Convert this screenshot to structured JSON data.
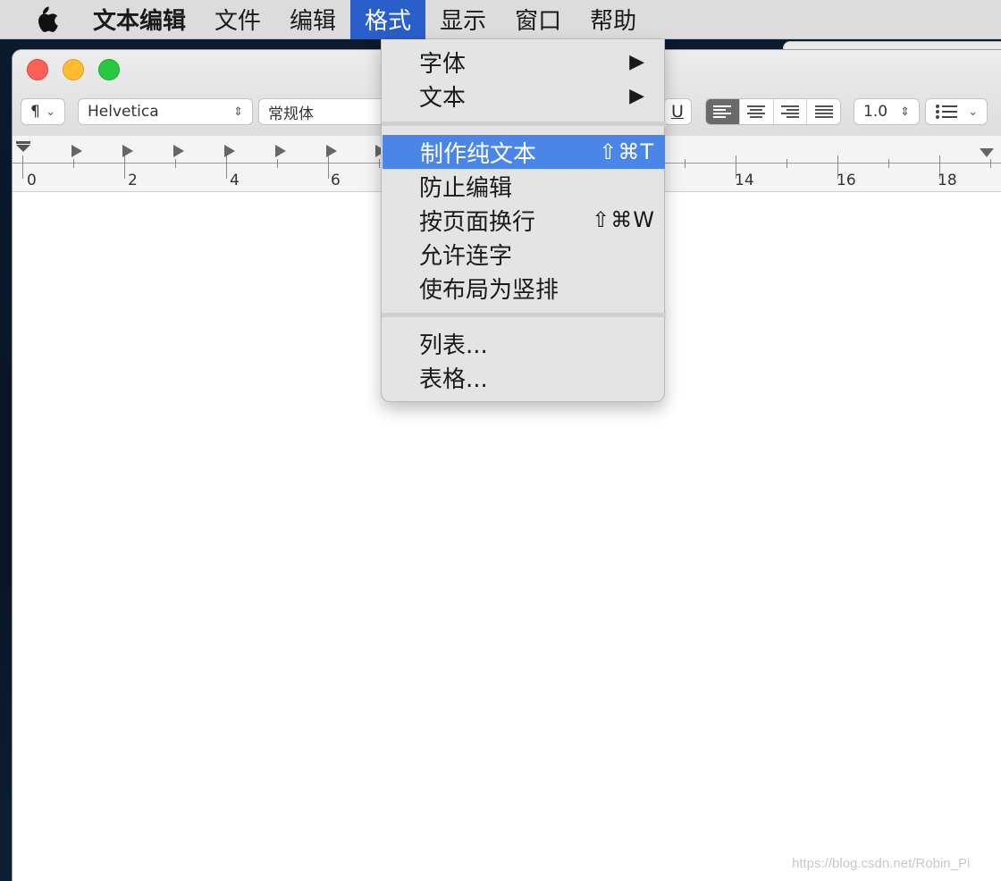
{
  "menubar": {
    "apple_icon": "apple-logo-icon",
    "items": [
      {
        "label": "文本编辑"
      },
      {
        "label": "文件"
      },
      {
        "label": "编辑"
      },
      {
        "label": "格式"
      },
      {
        "label": "显示"
      },
      {
        "label": "窗口"
      },
      {
        "label": "帮助"
      }
    ]
  },
  "toolbar": {
    "paragraph_symbol": "¶",
    "font_family": "Helvetica",
    "font_style": "常规体",
    "underline": "U",
    "line_spacing": "1.0"
  },
  "ruler": {
    "numbers": [
      "0",
      "2",
      "4",
      "6",
      "14",
      "16",
      "18"
    ]
  },
  "format_menu": {
    "items": [
      {
        "label": "字体",
        "submenu": true
      },
      {
        "label": "文本",
        "submenu": true
      },
      {
        "label": "制作纯文本",
        "shortcut": "⇧⌘T",
        "highlighted": true
      },
      {
        "label": "防止编辑"
      },
      {
        "label": "按页面换行",
        "shortcut": "⇧⌘W"
      },
      {
        "label": "允许连字"
      },
      {
        "label": "使布局为竖排"
      },
      {
        "label": "列表..."
      },
      {
        "label": "表格..."
      }
    ]
  },
  "watermark": "https://blog.csdn.net/Robin_Pi",
  "colors": {
    "menu_highlight": "#2a5ec8",
    "item_highlight": "#4a86e8",
    "close": "#fe5f57",
    "minimize": "#febc2e",
    "maximize": "#28c840"
  }
}
